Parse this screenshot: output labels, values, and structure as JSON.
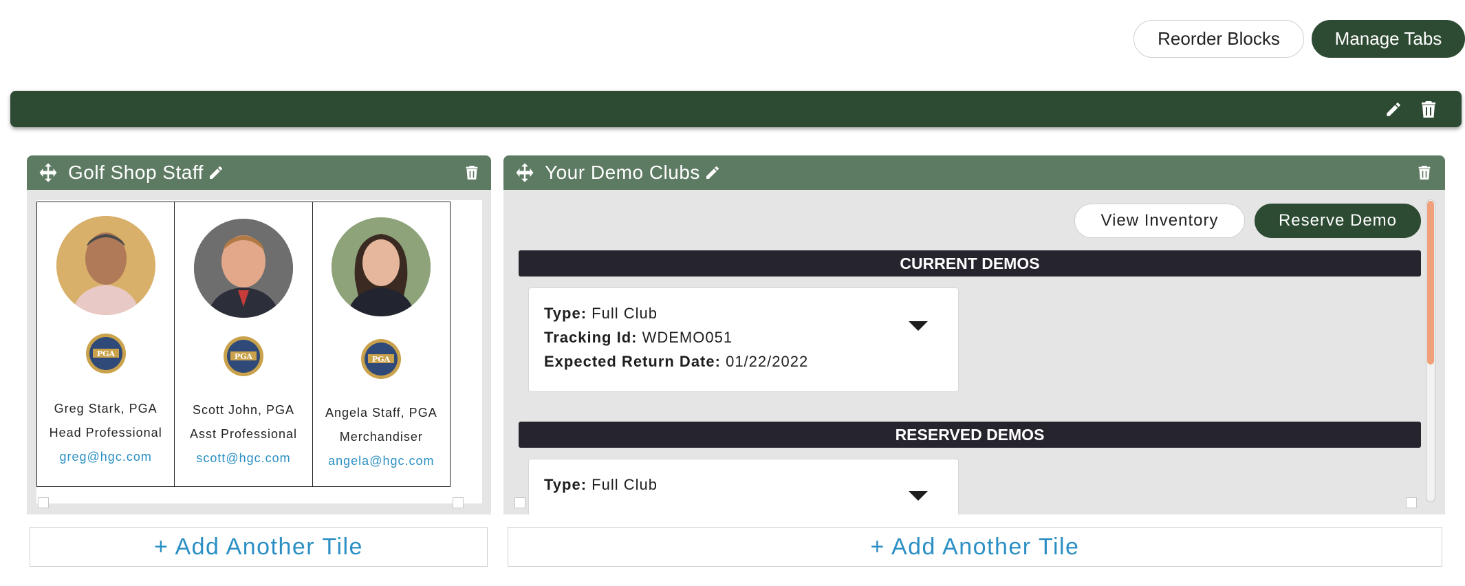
{
  "toolbar": {
    "reorder_label": "Reorder Blocks",
    "manage_tabs_label": "Manage Tabs"
  },
  "colors": {
    "brand_dark_green": "#2d4a32",
    "panel_header_green": "#5d7a62",
    "section_bar": "#26252e",
    "link_blue": "#2b8fc4",
    "scrollbar_thumb": "#f0a07a"
  },
  "icons": {
    "bar_edit": "pencil-icon",
    "bar_delete": "trash-icon",
    "tile_move": "move-arrows-icon",
    "tile_edit": "pencil-icon",
    "tile_delete": "trash-icon",
    "card_toggle": "caret-down-icon"
  },
  "staff_tile": {
    "title": "Golf Shop Staff",
    "members": [
      {
        "name": "Greg Stark, PGA",
        "role": "Head Professional",
        "email": "greg@hgc.com"
      },
      {
        "name": "Scott John, PGA",
        "role": "Asst Professional",
        "email": "scott@hgc.com"
      },
      {
        "name": "Angela Staff, PGA",
        "role": "Merchandiser",
        "email": "angela@hgc.com"
      }
    ],
    "add_tile_label": "+ Add Another Tile"
  },
  "demo_tile": {
    "title": "Your Demo Clubs",
    "view_inventory_label": "View Inventory",
    "reserve_demo_label": "Reserve Demo",
    "current_heading": "CURRENT DEMOS",
    "reserved_heading": "RESERVED DEMOS",
    "current_card": {
      "type_label": "Type:",
      "type_value": "Full Club",
      "tracking_label": "Tracking Id:",
      "tracking_value": "WDEMO051",
      "return_label": "Expected Return Date:",
      "return_value": "01/22/2022"
    },
    "reserved_card": {
      "type_label": "Type:",
      "type_value": "Full Club"
    },
    "add_tile_label": "+ Add Another Tile"
  }
}
